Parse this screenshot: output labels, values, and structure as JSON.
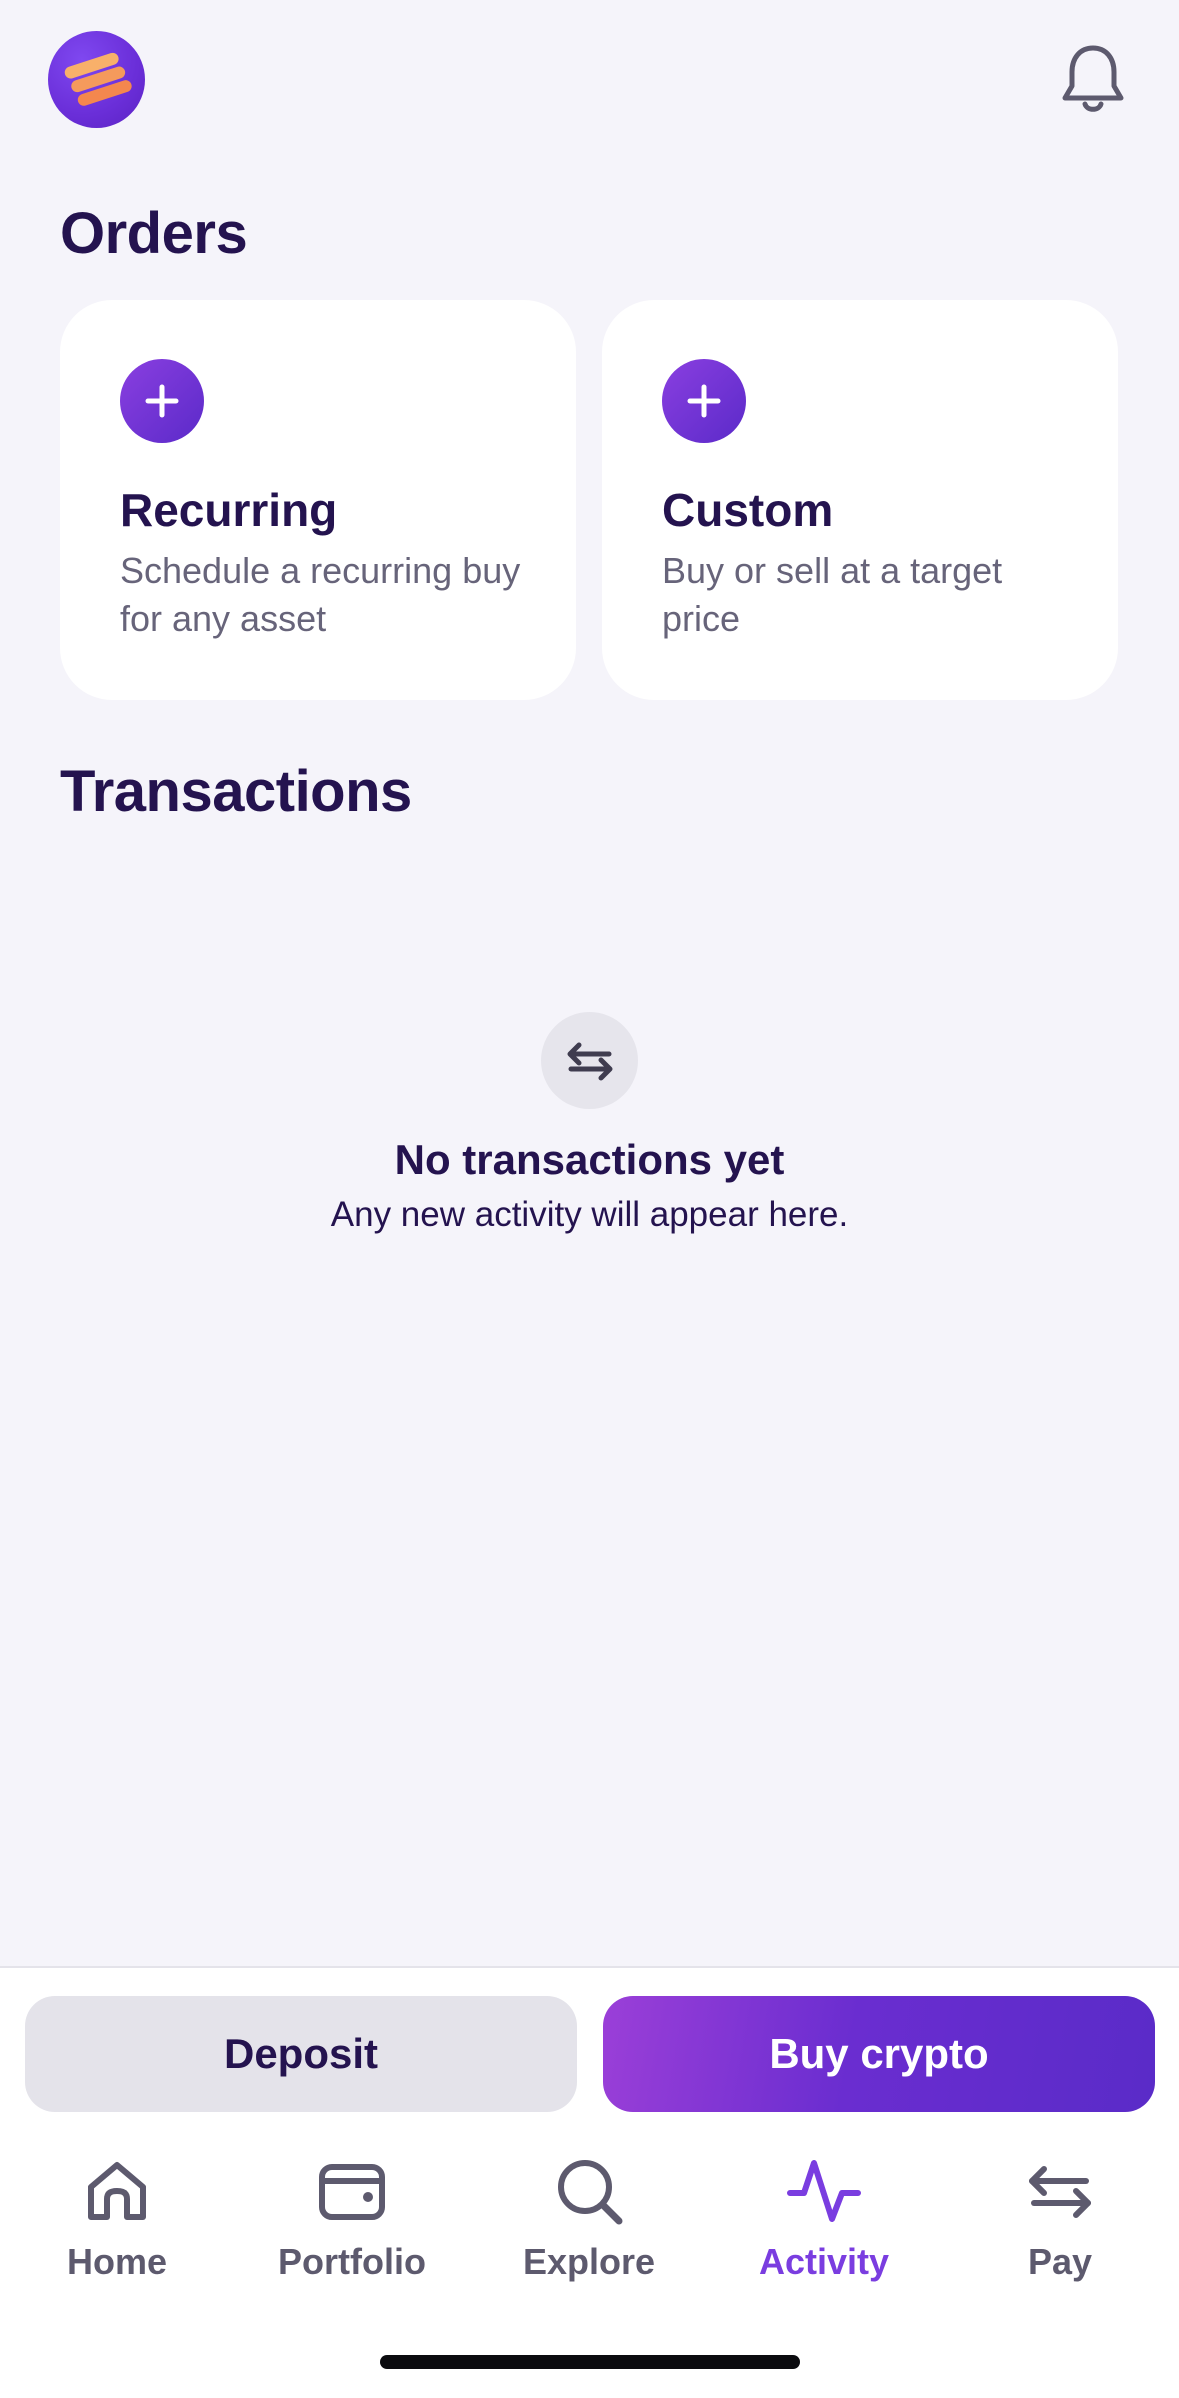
{
  "header": {
    "avatar_icon": "stacked-bars-logo-icon",
    "notification_icon": "bell-icon"
  },
  "orders": {
    "title": "Orders",
    "cards": [
      {
        "title": "Recurring",
        "description": "Schedule a recurring buy for any asset",
        "icon": "plus-icon"
      },
      {
        "title": "Custom",
        "description": "Buy or sell at a target price",
        "icon": "plus-icon"
      }
    ]
  },
  "transactions": {
    "title": "Transactions",
    "empty_icon": "swap-arrows-icon",
    "empty_title": "No transactions yet",
    "empty_subtitle": "Any new activity will appear here."
  },
  "actions": {
    "deposit_label": "Deposit",
    "buy_label": "Buy crypto"
  },
  "tabbar": {
    "items": [
      {
        "label": "Home",
        "icon": "home-icon",
        "active": false
      },
      {
        "label": "Portfolio",
        "icon": "wallet-icon",
        "active": false
      },
      {
        "label": "Explore",
        "icon": "search-icon",
        "active": false
      },
      {
        "label": "Activity",
        "icon": "activity-icon",
        "active": true
      },
      {
        "label": "Pay",
        "icon": "swap-arrows-icon",
        "active": false
      }
    ]
  },
  "colors": {
    "background": "#f5f4fa",
    "primary_text": "#24134f",
    "accent": "#7a3de0",
    "accent_dark": "#5a2bc8"
  }
}
